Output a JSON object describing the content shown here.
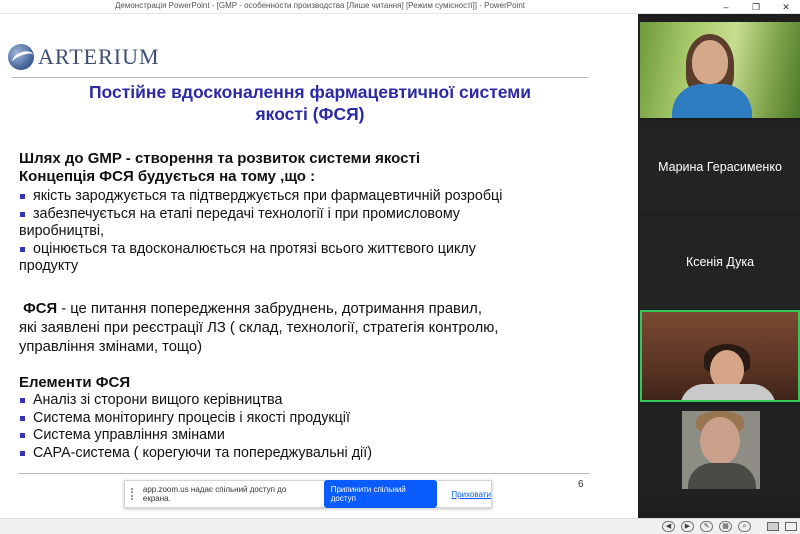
{
  "window": {
    "title": "Демонстрація PowerPoint - [GMP - особенности производства [Лише читання] [Режим сумісності]] - PowerPoint",
    "minimize": "–",
    "restore": "❐",
    "close": "✕"
  },
  "slide": {
    "logo_text": "ARTERIUM",
    "title_line1": "Постійне вдосконалення  фармацевтичної  системи",
    "title_line2": "якості (ФСЯ)",
    "heading1": "Шлях до  GMP -  створення та розвиток системи якості",
    "heading2": "Концепція ФСЯ  будується на тому ,що  :",
    "bullets1": [
      "якість зароджується  та підтверджується при фармацевтичній розробці",
      "забезпечується на етапі передачі  технології і при промисловому",
      "оцінюється  та вдосконалюється на протязі всього життєвого циклу"
    ],
    "bullet2_cont": "виробництві,",
    "bullet3_cont": "продукту",
    "fsya_label": "ФСЯ",
    "fsya_text1": "  -  це питання попередження забруднень, дотримання правил,",
    "fsya_text2": "які заявлені при реєстрації ЛЗ ( склад, технології, стратегія контролю,",
    "fsya_text3": "управління змінами, тощо)",
    "elements_heading": "Елементи  ФСЯ",
    "elements": [
      "Аналіз  зі сторони  вищого керівництва",
      "Система моніторингу процесів і якості продукції",
      "Система управління змінами",
      "САРА-система ( корегуючи та попереджувальні дії)"
    ],
    "page_number": "6"
  },
  "share_bar": {
    "message": "app.zoom.us надає спільний доступ до екрана.",
    "stop_label": "Припинити спільний доступ",
    "hide_label": "Приховати"
  },
  "participants": [
    {
      "name": ""
    },
    {
      "name": "Марина Герасименко"
    },
    {
      "name": "Ксенія Дука"
    },
    {
      "name": ""
    },
    {
      "name": ""
    }
  ],
  "accent_colors": {
    "title": "#2b2aa6",
    "bullet": "#3434b8",
    "active_speaker_border": "#34c759",
    "stop_button": "#0b5cff"
  }
}
